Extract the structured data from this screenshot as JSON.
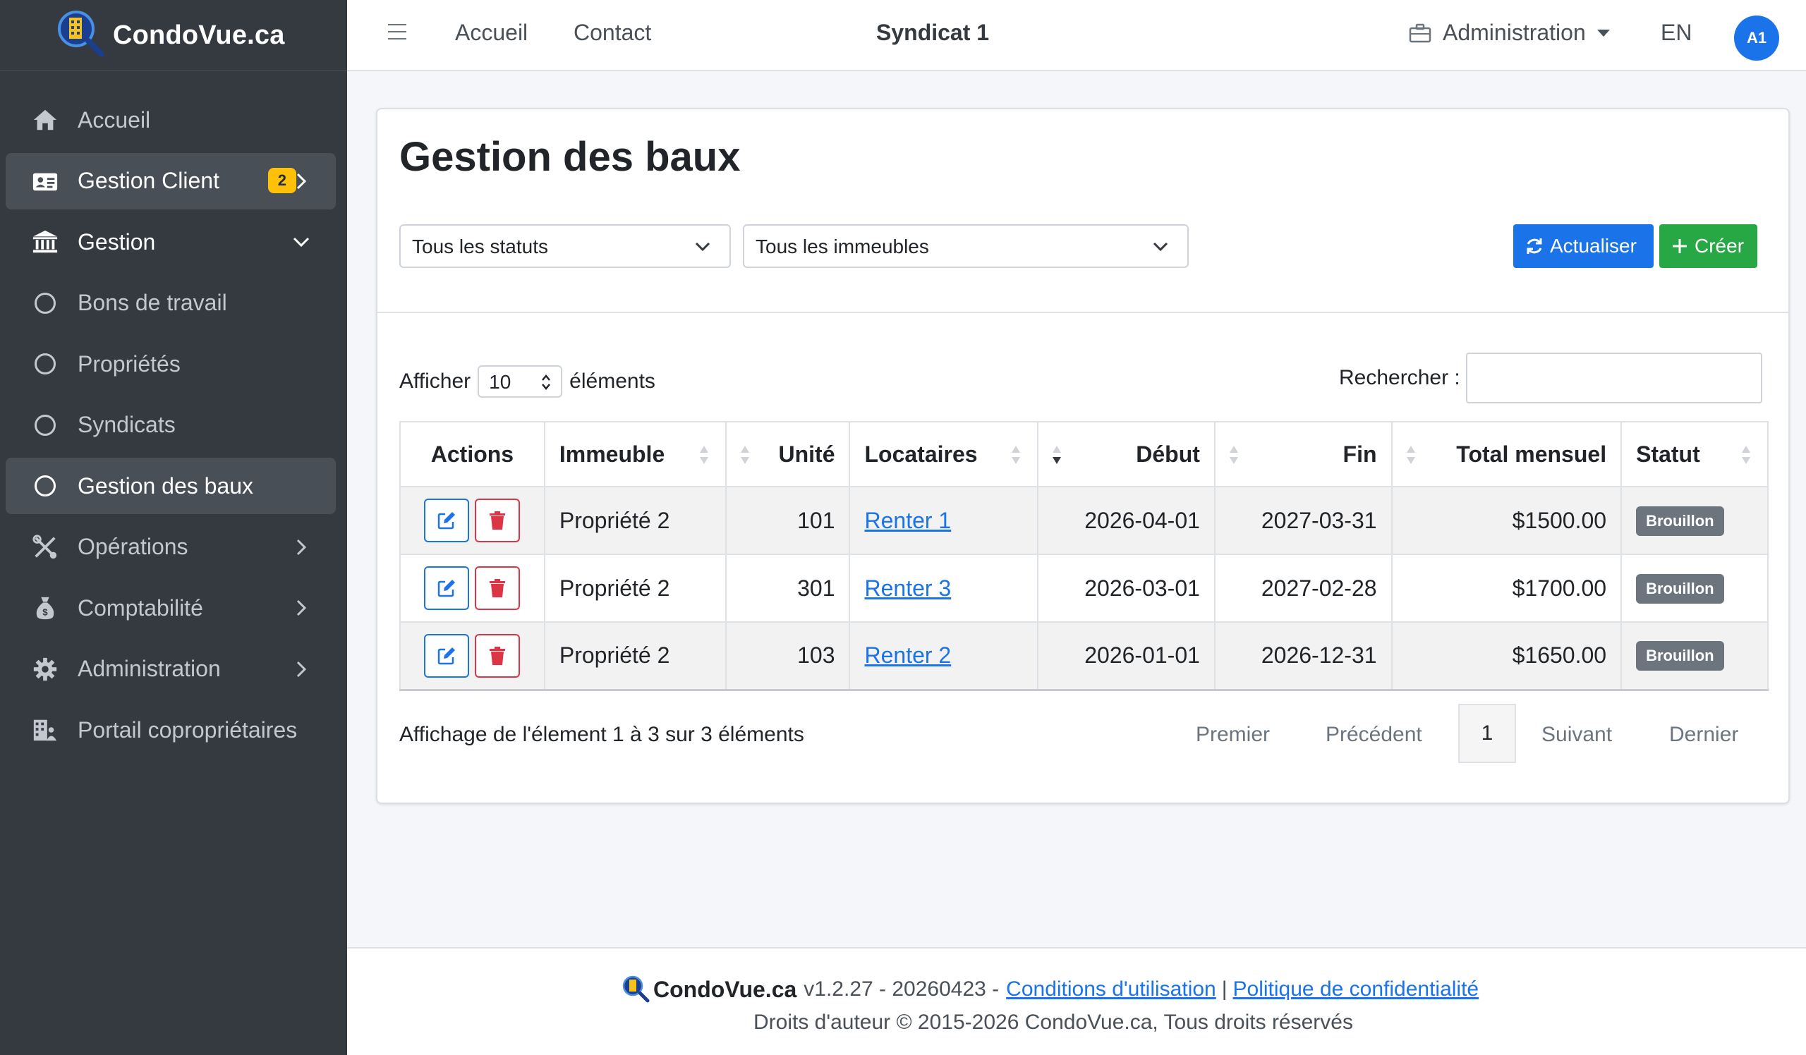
{
  "brand": {
    "name": "CondoVue.ca"
  },
  "sidebar": {
    "items": [
      {
        "label": "Accueil",
        "icon": "home-icon"
      },
      {
        "label": "Gestion Client",
        "icon": "id-card-icon",
        "badge": "2"
      },
      {
        "label": "Gestion",
        "icon": "bank-icon"
      },
      {
        "label": "Bons de travail",
        "icon": "circle-icon"
      },
      {
        "label": "Propriétés",
        "icon": "circle-icon"
      },
      {
        "label": "Syndicats",
        "icon": "circle-icon"
      },
      {
        "label": "Gestion des baux",
        "icon": "circle-icon"
      },
      {
        "label": "Opérations",
        "icon": "tools-icon"
      },
      {
        "label": "Comptabilité",
        "icon": "money-bag-icon"
      },
      {
        "label": "Administration",
        "icon": "gear-icon"
      },
      {
        "label": "Portail copropriétaires",
        "icon": "building-users-icon"
      }
    ]
  },
  "topbar": {
    "home": "Accueil",
    "contact": "Contact",
    "title": "Syndicat 1",
    "admin": "Administration",
    "lang": "EN",
    "avatar": "A1"
  },
  "page": {
    "title": "Gestion des baux",
    "filters": {
      "status": "Tous les statuts",
      "building": "Tous les immeubles"
    },
    "buttons": {
      "refresh": "Actualiser",
      "create": "Créer"
    }
  },
  "table": {
    "length_prefix": "Afficher",
    "length_value": "10",
    "length_suffix": "éléments",
    "search_label": "Rechercher :",
    "columns": [
      "Actions",
      "Immeuble",
      "Unité",
      "Locataires",
      "Début",
      "Fin",
      "Total mensuel",
      "Statut"
    ],
    "rows": [
      {
        "immeuble": "Propriété 2",
        "unite": "101",
        "locataire": "Renter 1",
        "debut": "2026-04-01",
        "fin": "2027-03-31",
        "total": "$1500.00",
        "statut": "Brouillon"
      },
      {
        "immeuble": "Propriété 2",
        "unite": "301",
        "locataire": "Renter 3",
        "debut": "2026-03-01",
        "fin": "2027-02-28",
        "total": "$1700.00",
        "statut": "Brouillon"
      },
      {
        "immeuble": "Propriété 2",
        "unite": "103",
        "locataire": "Renter 2",
        "debut": "2026-01-01",
        "fin": "2026-12-31",
        "total": "$1650.00",
        "statut": "Brouillon"
      }
    ],
    "info": "Affichage de l'élement 1 à 3 sur 3 éléments",
    "pagination": {
      "first": "Premier",
      "prev": "Précédent",
      "current": "1",
      "next": "Suivant",
      "last": "Dernier"
    }
  },
  "footer": {
    "brand": "CondoVue.ca",
    "version": "v1.2.27 - 20260423 -",
    "terms": "Conditions d'utilisation",
    "separator": "|",
    "privacy": "Politique de confidentialité",
    "copyright": "Droits d'auteur © 2015-2026 CondoVue.ca, Tous droits réservés"
  },
  "colors": {
    "sidebar": "#343a40",
    "primary": "#1a73e8",
    "success": "#28a745",
    "danger": "#dc3545",
    "badge_warning": "#ffc107",
    "status_badge": "#6c757d"
  }
}
